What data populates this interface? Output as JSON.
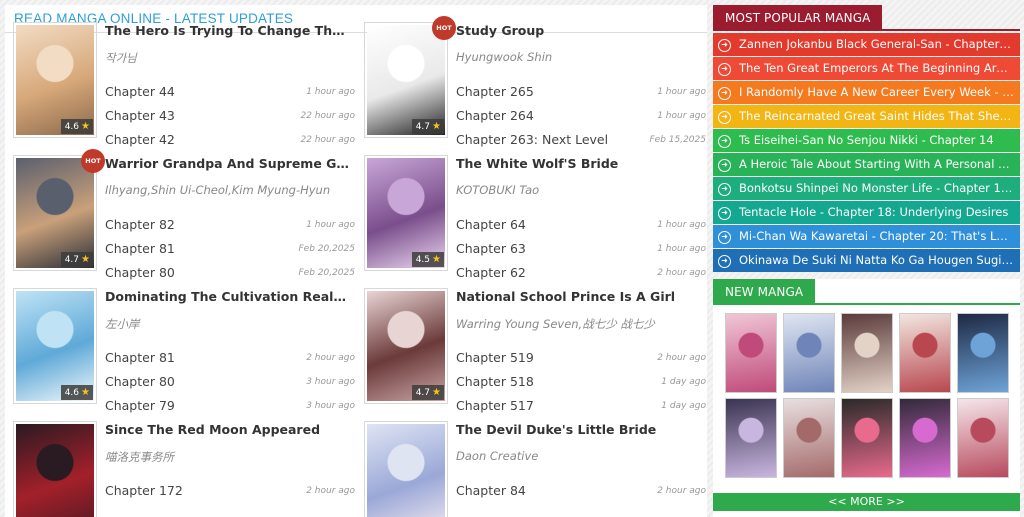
{
  "header": {
    "title": "READ MANGA ONLINE - LATEST UPDATES"
  },
  "cards": [
    {
      "title": "The Hero Is Trying To Change The H...",
      "author": "작가님",
      "rating": "4.6",
      "hot": "",
      "chapters": [
        {
          "name": "Chapter 44",
          "time": "1 hour ago"
        },
        {
          "name": "Chapter 43",
          "time": "22 hour ago"
        },
        {
          "name": "Chapter 42",
          "time": "22 hour ago"
        }
      ],
      "palette": [
        "#f2dcc4",
        "#d7a87a",
        "#8c6a4c"
      ]
    },
    {
      "title": "Study Group",
      "author": "Hyungwook Shin",
      "rating": "4.7",
      "hot": "HOT",
      "chapters": [
        {
          "name": "Chapter 265",
          "time": "1 hour ago"
        },
        {
          "name": "Chapter 264",
          "time": "1 hour ago"
        },
        {
          "name": "Chapter 263: Next Level",
          "time": "Feb 15,2025"
        }
      ],
      "palette": [
        "#ffffff",
        "#e9e9e9",
        "#222222"
      ]
    },
    {
      "title": "Warrior Grandpa And Supreme Gra...",
      "author": "Ilhyang,Shin Ui-Cheol,Kim Myung-Hyun",
      "rating": "4.7",
      "hot": "HOT",
      "chapters": [
        {
          "name": "Chapter 82",
          "time": "1 hour ago"
        },
        {
          "name": "Chapter 81",
          "time": "Feb 20,2025"
        },
        {
          "name": "Chapter 80",
          "time": "Feb 20,2025"
        }
      ],
      "palette": [
        "#5a5f6e",
        "#c9a07a",
        "#2c2f38"
      ]
    },
    {
      "title": "The White Wolf'S Bride",
      "author": "KOTOBUKI Tao",
      "rating": "4.5",
      "hot": "",
      "chapters": [
        {
          "name": "Chapter 64",
          "time": "1 hour ago"
        },
        {
          "name": "Chapter 63",
          "time": "1 hour ago"
        },
        {
          "name": "Chapter 62",
          "time": "2 hour ago"
        }
      ],
      "palette": [
        "#c8a7d8",
        "#7a4e8c",
        "#e9d6ee"
      ]
    },
    {
      "title": "Dominating The Cultivation Realm ...",
      "author": "左小岸",
      "rating": "4.6",
      "hot": "",
      "chapters": [
        {
          "name": "Chapter 81",
          "time": "2 hour ago"
        },
        {
          "name": "Chapter 80",
          "time": "3 hour ago"
        },
        {
          "name": "Chapter 79",
          "time": "3 hour ago"
        }
      ],
      "palette": [
        "#bfe3f5",
        "#5fa9d8",
        "#f1f7fb"
      ]
    },
    {
      "title": "National School Prince Is A Girl",
      "author": "Warring Young Seven,战七少 战七少",
      "rating": "4.7",
      "hot": "",
      "chapters": [
        {
          "name": "Chapter 519",
          "time": "2 hour ago"
        },
        {
          "name": "Chapter 518",
          "time": "1 day ago"
        },
        {
          "name": "Chapter 517",
          "time": "1 day ago"
        }
      ],
      "palette": [
        "#e9d4d4",
        "#6b3a3a",
        "#c9a4a4"
      ]
    },
    {
      "title": "Since The Red Moon Appeared",
      "author": "喵洛克事务所",
      "rating": "",
      "hot": "",
      "chapters": [
        {
          "name": "Chapter 172",
          "time": "2 hour ago"
        }
      ],
      "palette": [
        "#2a1a22",
        "#a3202a",
        "#4e1a22"
      ]
    },
    {
      "title": "The Devil Duke's Little Bride",
      "author": "Daon Creative",
      "rating": "",
      "hot": "",
      "chapters": [
        {
          "name": "Chapter 84",
          "time": "2 hour ago"
        }
      ],
      "palette": [
        "#dfe4f3",
        "#9aa8d8",
        "#f3e9f1"
      ]
    }
  ],
  "popular": {
    "heading": "MOST POPULAR MANGA",
    "accent": "#9b1b2f",
    "items": [
      {
        "label": "Zannen Jokanbu Black General-San - Chapter 1...",
        "color": "#e23b2e"
      },
      {
        "label": "The Ten Great Emperors At The Beginning Are ...",
        "color": "#ef4a35"
      },
      {
        "label": "I Randomly Have A New Career Every Week - C...",
        "color": "#f57a1f"
      },
      {
        "label": "The Reincarnated Great Saint Hides That She's ...",
        "color": "#f3b514"
      },
      {
        "label": "Ts Eiseihei-San No Senjou Nikki - Chapter 14",
        "color": "#2ebc4f"
      },
      {
        "label": "A Heroic Tale About Starting With A Personal R...",
        "color": "#29b359"
      },
      {
        "label": "Bonkotsu Shinpei No Monster Life - Chapter 10...",
        "color": "#1eae7d"
      },
      {
        "label": "Tentacle Hole - Chapter 18: Underlying Desires",
        "color": "#15a891"
      },
      {
        "label": "Mi-Chan Wa Kawaretai - Chapter 20: That's Love",
        "color": "#2f8fd8"
      },
      {
        "label": "Okinawa De Suki Ni Natta Ko Ga Hougen Sugit...",
        "color": "#1f6fb6"
      }
    ]
  },
  "new_manga": {
    "heading": "NEW MANGA",
    "accent": "#2ea94c",
    "more_label": "<< MORE >>",
    "covers": [
      {
        "colors": [
          "#f0c6d6",
          "#c04a7a"
        ]
      },
      {
        "colors": [
          "#dfe6f2",
          "#6f84b8"
        ]
      },
      {
        "colors": [
          "#5b3b3b",
          "#e3d2c6"
        ]
      },
      {
        "colors": [
          "#f2e6e0",
          "#b8474f"
        ]
      },
      {
        "colors": [
          "#1e2a44",
          "#6ea3d8"
        ]
      },
      {
        "colors": [
          "#3b3452",
          "#c9b6e0"
        ]
      },
      {
        "colors": [
          "#e8dfe0",
          "#a46a6a"
        ]
      },
      {
        "colors": [
          "#2a2a2a",
          "#e86a8c"
        ]
      },
      {
        "colors": [
          "#332a3a",
          "#d66ad0"
        ]
      },
      {
        "colors": [
          "#f4e6ea",
          "#b84a5e"
        ]
      }
    ]
  }
}
